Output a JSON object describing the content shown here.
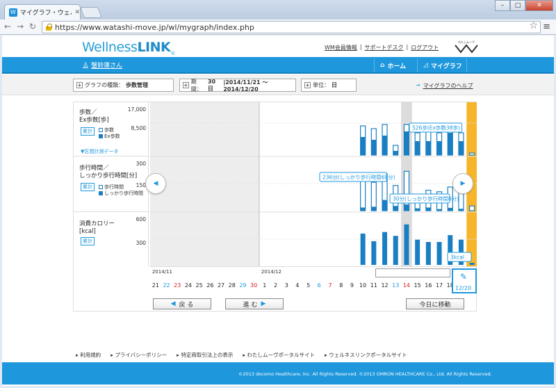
{
  "browser": {
    "tab_title": "マイグラフ・ウェルネス",
    "url": "https://www.watashi-move.jp/wl/mygraph/index.php",
    "window_buttons": [
      "–",
      "□",
      "✕"
    ]
  },
  "header": {
    "logo_a": "Wellness",
    "logo_b": "LINK",
    "logo_reg": "®",
    "links": [
      "WM会員情報",
      "サポートデスク",
      "ログアウト"
    ],
    "separator": "|",
    "brand2": "わたしムーヴ"
  },
  "navbar": {
    "user": "蟹鈴蓮さん",
    "home": "ホーム",
    "mygraph": "マイグラフ"
  },
  "controls": {
    "graph_type_label": "グラフの種類：",
    "graph_type_value": "歩数管理",
    "period_label": "期間：",
    "period_days": "30 日",
    "period_range": "|2014/11/21 ～ 2014/12/20",
    "unit_label": "単位：",
    "unit_value": "日",
    "help": "マイグラフのヘルプ"
  },
  "sections": [
    {
      "title1": "歩数／",
      "title2": "Ex歩数[歩]",
      "ax_top": "17,000",
      "ax_mid": "8,500",
      "btn": "累計",
      "legend": [
        "歩数",
        "Ex歩数"
      ],
      "extra": "▼区間計測データ"
    },
    {
      "title1": "歩行時間／",
      "title2": "しっかり歩行時間[分]",
      "ax_top": "300",
      "ax_mid": "150",
      "btn": "累計",
      "legend": [
        "歩行時間",
        "しっかり歩行時間"
      ]
    },
    {
      "title1": "消費カロリー",
      "title2": "[kcal]",
      "ax_top": "600",
      "ax_mid": "300",
      "btn": "累計"
    }
  ],
  "tooltips": {
    "steps": "526歩(Ex歩数38歩)",
    "walk_prev": "236分(しっかり歩行時間68分)",
    "walk_cur": "30分(しっかり歩行時間0分)",
    "kcal": "3kcal"
  },
  "chart_data": {
    "type": "bar",
    "months": [
      "2014/11",
      "2014/12"
    ],
    "dates": [
      "21",
      "22",
      "23",
      "24",
      "25",
      "26",
      "27",
      "28",
      "29",
      "30",
      "1",
      "2",
      "3",
      "4",
      "5",
      "6",
      "7",
      "8",
      "9",
      "10",
      "11",
      "12",
      "13",
      "14",
      "15",
      "16",
      "17",
      "18",
      "19",
      "20"
    ],
    "date_colors": [
      "#222",
      "#1e97dc",
      "#d42020",
      "#222",
      "#222",
      "#222",
      "#222",
      "#222",
      "#1e97dc",
      "#d42020",
      "#222",
      "#222",
      "#222",
      "#222",
      "#222",
      "#1e97dc",
      "#d42020",
      "#222",
      "#222",
      "#222",
      "#222",
      "#222",
      "#1e97dc",
      "#d42020",
      "#222",
      "#222",
      "#222",
      "#222",
      "#222",
      "#222"
    ],
    "steps": [
      0,
      0,
      0,
      0,
      0,
      0,
      0,
      0,
      0,
      0,
      0,
      0,
      0,
      0,
      0,
      0,
      0,
      0,
      0,
      10500,
      9500,
      11000,
      3500,
      11000,
      8000,
      9000,
      8000,
      11000,
      8000,
      526
    ],
    "ex_steps": [
      0,
      0,
      0,
      0,
      0,
      0,
      0,
      0,
      0,
      0,
      0,
      0,
      0,
      0,
      0,
      0,
      0,
      0,
      0,
      6500,
      5500,
      7000,
      1500,
      8500,
      5000,
      5000,
      5000,
      8000,
      5000,
      38
    ],
    "walk_minutes": [
      0,
      0,
      0,
      0,
      0,
      0,
      0,
      0,
      0,
      0,
      0,
      0,
      0,
      0,
      0,
      0,
      0,
      0,
      0,
      200,
      180,
      236,
      160,
      250,
      100,
      130,
      120,
      150,
      120,
      30
    ],
    "brisk_minutes": [
      0,
      0,
      0,
      0,
      0,
      0,
      0,
      0,
      0,
      0,
      0,
      0,
      0,
      0,
      0,
      0,
      0,
      0,
      0,
      20,
      25,
      68,
      30,
      40,
      15,
      20,
      10,
      18,
      12,
      0
    ],
    "kcal": [
      0,
      0,
      0,
      0,
      0,
      0,
      0,
      0,
      0,
      0,
      0,
      0,
      0,
      0,
      0,
      0,
      0,
      0,
      0,
      410,
      310,
      430,
      380,
      530,
      330,
      300,
      300,
      390,
      330,
      3
    ],
    "steps_ylim": [
      0,
      17000
    ],
    "walk_ylim": [
      0,
      300
    ],
    "kcal_ylim": [
      0,
      600
    ],
    "selected_date": "12/20",
    "highlight_index": 23
  },
  "buttons": {
    "back": "戻 る",
    "next": "進 む",
    "today": "今日に移動"
  },
  "footer": {
    "links": [
      "利用規約",
      "プライバシーポリシー",
      "特定商取引法上の表示",
      "わたしムーヴポータルサイト",
      "ウェルネスリンクポータルサイト"
    ],
    "copyright": "©2013 docomo Healthcare, Inc. All Rights Reserved. ©2013 OMRON HEALTHCARE Co., Ltd. All Rights Reserved."
  }
}
